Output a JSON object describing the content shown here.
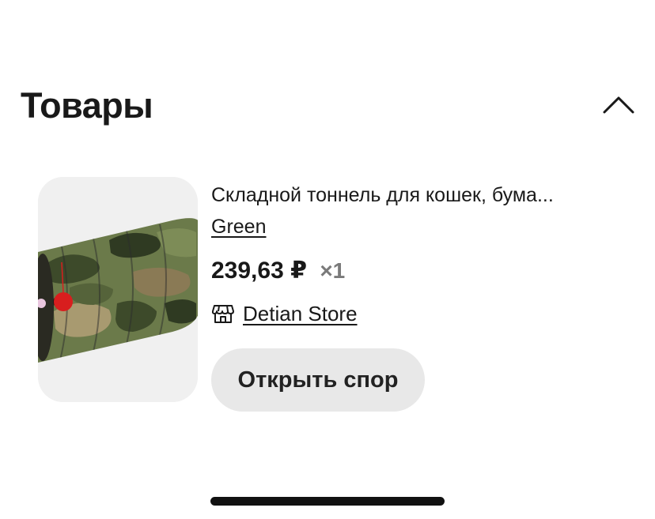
{
  "section": {
    "title": "Товары",
    "toggle_icon": "chevron-up-icon"
  },
  "product": {
    "image_icon": "cat-tunnel-product-image",
    "title": "Складной тоннель для кошек, бума...",
    "variant": "Green",
    "price": "239,63 ₽",
    "quantity": "×1",
    "store_icon": "storefront-icon",
    "store_name": "Detian Store",
    "dispute_label": "Открыть спор"
  },
  "colors": {
    "text": "#191919",
    "muted": "#7a7a7a",
    "button_bg": "#e8e8e8",
    "thumb_bg": "#eeeeee"
  }
}
